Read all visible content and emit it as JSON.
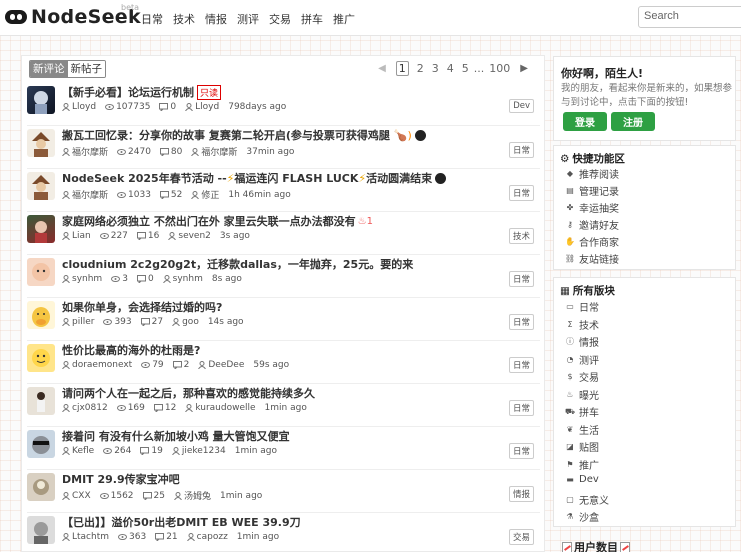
{
  "header": {
    "logo": "NodeSeek",
    "beta": "beta",
    "nav": [
      "日常",
      "技术",
      "情报",
      "测评",
      "交易",
      "拼车",
      "推广"
    ],
    "search_placeholder": "Search"
  },
  "main": {
    "tabs": [
      "新评论",
      "新帖子"
    ],
    "pager": [
      "1",
      "2",
      "3",
      "4",
      "5",
      "...",
      "100"
    ],
    "posts": [
      {
        "title": "【新手必看】论坛运行机制",
        "tag": "只读",
        "author": "Lloyd",
        "views": "107735",
        "comments": "0",
        "last": "Lloyd",
        "time": "798days ago",
        "category": "Dev"
      },
      {
        "title": "搬瓦工回忆录：分享你的故事 复赛第二轮开启(参与投票可获得鸡腿",
        "author": "福尔摩斯",
        "views": "2470",
        "comments": "80",
        "last": "福尔摩斯",
        "time": "37min ago",
        "category": "日常"
      },
      {
        "title": "NodeSeek 2025年春节活动 -- ",
        "title_mid": "福运连闪 FLASH LUCK ",
        "title_end": "活动圆满结束",
        "author": "福尔摩斯",
        "views": "1033",
        "comments": "52",
        "last": "修正",
        "time": "1h 46min ago",
        "category": "日常"
      },
      {
        "title": "家庭网络必须独立 不然出门在外 家里云失联一点办法都没有",
        "hot": "1",
        "author": "Lian",
        "views": "227",
        "comments": "16",
        "last": "seven2",
        "time": "3s ago",
        "category": "技术"
      },
      {
        "title": "cloudnium 2c2g20g2t，迁移款dallas，一年抛弃，25元。要的来",
        "author": "synhm",
        "views": "3",
        "comments": "0",
        "last": "synhm",
        "time": "8s ago",
        "category": "日常"
      },
      {
        "title": "如果你单身，会选择结过婚的吗?",
        "author": "piller",
        "views": "393",
        "comments": "27",
        "last": "goo",
        "time": "14s ago",
        "category": "日常"
      },
      {
        "title": "性价比最高的海外的杜雨是?",
        "author": "doraemonext",
        "views": "79",
        "comments": "2",
        "last": "DeeDee",
        "time": "59s ago",
        "category": "日常"
      },
      {
        "title": "请问两个人在一起之后，那种喜欢的感觉能持续多久",
        "author": "cjx0812",
        "views": "169",
        "comments": "12",
        "last": "kuraudowelle",
        "time": "1min ago",
        "category": "日常"
      },
      {
        "title": "接着问 有没有什么新加坡小鸡 量大管饱又便宜",
        "author": "Kefle",
        "views": "264",
        "comments": "19",
        "last": "jieke1234",
        "time": "1min ago",
        "category": "日常"
      },
      {
        "title": "DMIT 29.9传家宝冲吧",
        "author": "CXX",
        "views": "1562",
        "comments": "25",
        "last": "汤姆兔",
        "time": "1min ago",
        "category": "情报"
      },
      {
        "title": "【已出】】溢价50r出老DMIT EB WEE 39.9刀",
        "author": "Ltachtm",
        "views": "363",
        "comments": "21",
        "last": "capozz",
        "time": "1min ago",
        "category": "交易"
      }
    ]
  },
  "sidebar": {
    "greet_title": "你好啊，陌生人!",
    "greet_text": "我的朋友，看起来你是新来的，如果想参与到讨论中，点击下面的按钮!",
    "login": "登录",
    "register": "注册",
    "quick_title": "快捷功能区",
    "quick_items": [
      "推荐阅读",
      "管理记录",
      "幸运抽奖",
      "邀请好友",
      "合作商家",
      "友站链接"
    ],
    "boards_title": "所有版块",
    "boards": [
      "日常",
      "技术",
      "情报",
      "测评",
      "交易",
      "曝光",
      "拼车",
      "生活",
      "贴图",
      "推广",
      "Dev",
      "无意义",
      "沙盒"
    ],
    "user_count": "用户数目"
  },
  "colors": {
    "accent_green": "#2ea043",
    "readonly_red": "#dd0000",
    "bolt": "#e9a400"
  }
}
